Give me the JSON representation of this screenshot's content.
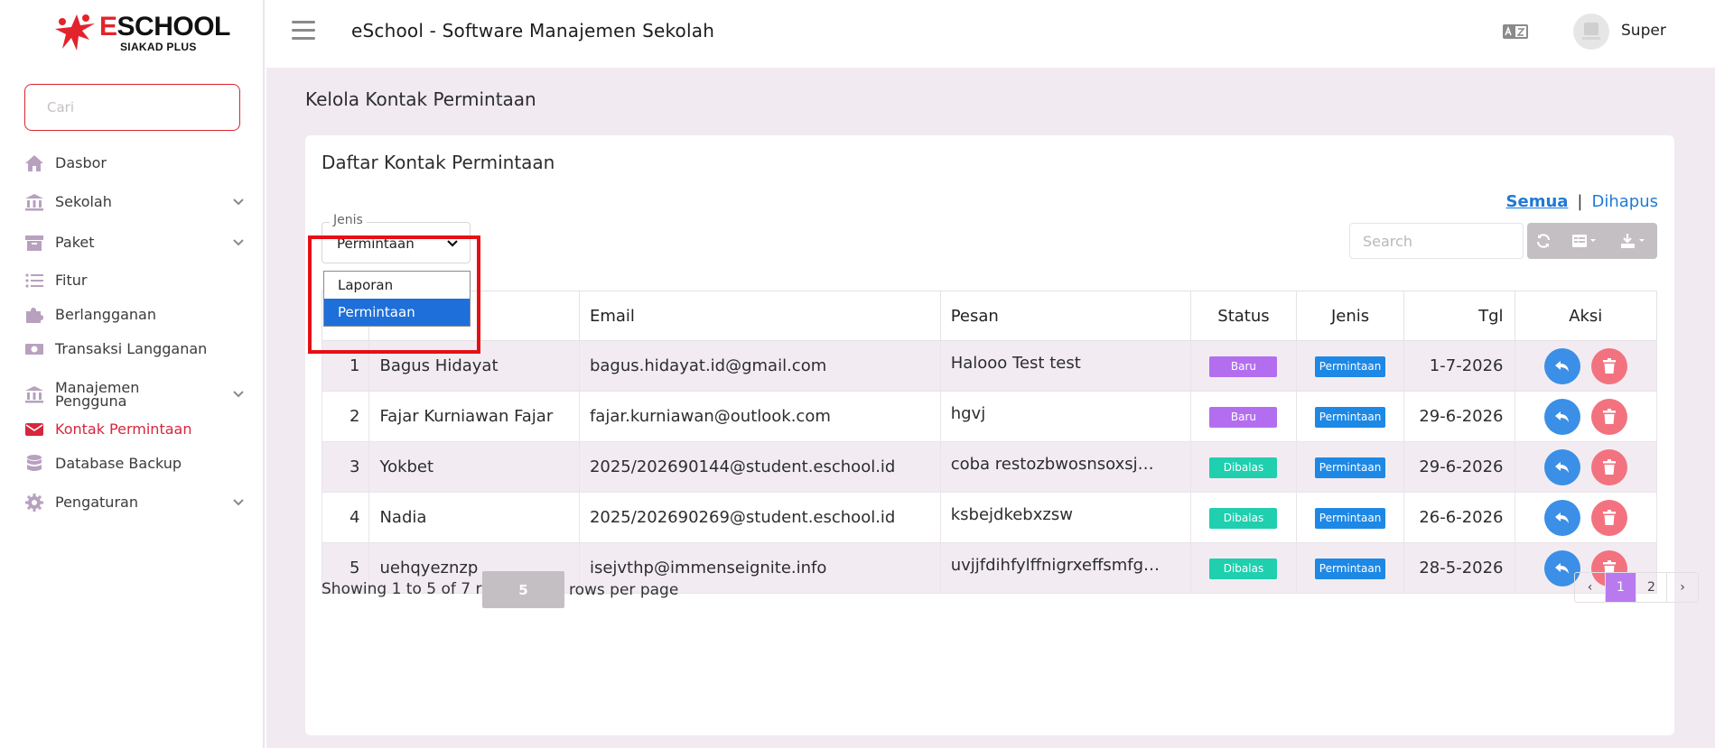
{
  "app": {
    "logo_brand_first": "E",
    "logo_brand_rest": "SCHOOL",
    "logo_sub": "SIAKAD PLUS",
    "title": "eSchool - Software Manajemen Sekolah",
    "user_name": "Super"
  },
  "sidebar": {
    "search_placeholder": "Cari",
    "items": [
      {
        "label": "Dasbor",
        "icon": "home-icon"
      },
      {
        "label": "Sekolah",
        "icon": "school-icon",
        "expandable": true
      },
      {
        "label": "Paket",
        "icon": "package-icon",
        "expandable": true
      },
      {
        "label": "Fitur",
        "icon": "list-icon"
      },
      {
        "label": "Berlangganan",
        "icon": "puzzle-icon"
      },
      {
        "label": "Transaksi Langganan",
        "icon": "money-icon"
      },
      {
        "label": "Manajemen Pengguna",
        "icon": "users-icon",
        "expandable": true
      },
      {
        "label": "Kontak Permintaan",
        "icon": "mail-icon",
        "active": true
      },
      {
        "label": "Database Backup",
        "icon": "database-icon"
      },
      {
        "label": "Pengaturan",
        "icon": "gear-icon",
        "expandable": true
      }
    ]
  },
  "page": {
    "title": "Kelola Kontak Permintaan",
    "card_title": "Daftar Kontak Permintaan",
    "view_all": "Semua",
    "view_sep": "|",
    "view_deleted": "Dihapus"
  },
  "filter": {
    "legend": "Jenis",
    "selected": "Permintaan",
    "options": [
      "Laporan",
      "Permintaan"
    ]
  },
  "toolbar": {
    "search_placeholder": "Search"
  },
  "table": {
    "headers": [
      "",
      "",
      "Email",
      "Pesan",
      "Status",
      "Jenis",
      "Tgl",
      "Aksi"
    ],
    "rows": [
      {
        "no": "1",
        "nama": "Bagus Hidayat",
        "email": "bagus.hidayat.id@gmail.com",
        "pesan": "Halooo Test test",
        "status": "Baru",
        "jenis": "Permintaan",
        "tgl": "1-7-2026"
      },
      {
        "no": "2",
        "nama": "Fajar Kurniawan Fajar",
        "email": "fajar.kurniawan@outlook.com",
        "pesan": "hgvj",
        "status": "Baru",
        "jenis": "Permintaan",
        "tgl": "29-6-2026"
      },
      {
        "no": "3",
        "nama": "Yokbet",
        "email": "2025/202690144@student.eschool.id",
        "pesan": "coba restozbwosnsoxsj…",
        "status": "Dibalas",
        "jenis": "Permintaan",
        "tgl": "29-6-2026"
      },
      {
        "no": "4",
        "nama": "Nadia",
        "email": "2025/202690269@student.eschool.id",
        "pesan": "ksbejdkebxzsw",
        "status": "Dibalas",
        "jenis": "Permintaan",
        "tgl": "26-6-2026"
      },
      {
        "no": "5",
        "nama": "uehqyeznzp",
        "email": "isejvthp@immenseignite.info",
        "pesan": "uvjjfdihfylffnigrxeffsmfg…",
        "status": "Dibalas",
        "jenis": "Permintaan",
        "tgl": "28-5-2026"
      }
    ]
  },
  "footer": {
    "showing": "Showing 1 to 5 of 7 rows",
    "page_size": "5",
    "rows_per_page": "rows per page",
    "pager": {
      "prev": "‹",
      "pages": [
        "1",
        "2"
      ],
      "next": "›",
      "current": "1"
    }
  },
  "colors": {
    "brand_red": "#d7263d",
    "status_baru": "#b36ef0",
    "status_dibalas": "#1fcfae",
    "jenis_badge": "#1e88e5",
    "link_blue": "#1f7ad6",
    "reply_button": "#3b8fe6",
    "delete_button": "#f3727f",
    "sidebar_icon": "#b7a1bf"
  }
}
